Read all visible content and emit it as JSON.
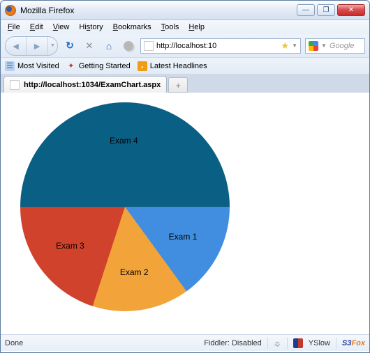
{
  "window": {
    "title": "Mozilla Firefox"
  },
  "menu": {
    "file": "File",
    "edit": "Edit",
    "view": "View",
    "history": "History",
    "bookmarks": "Bookmarks",
    "tools": "Tools",
    "help": "Help"
  },
  "toolbar": {
    "url_display": "http://localhost:10",
    "search_placeholder": "Google"
  },
  "bookmarks": {
    "most_visited": "Most Visited",
    "getting_started": "Getting Started",
    "latest_headlines": "Latest Headlines"
  },
  "tab": {
    "title": "http://localhost:1034/ExamChart.aspx"
  },
  "status": {
    "left": "Done",
    "fiddler": "Fiddler: Disabled",
    "yslow": "YSlow",
    "s3fox_s3": "S3",
    "s3fox_fox": "Fox"
  },
  "chart_data": {
    "type": "pie",
    "title": "",
    "series": [
      {
        "name": "Exam 1",
        "value": 15,
        "color": "#418ee0"
      },
      {
        "name": "Exam 2",
        "value": 15,
        "color": "#f2a43b"
      },
      {
        "name": "Exam 3",
        "value": 20,
        "color": "#d1422c"
      },
      {
        "name": "Exam 4",
        "value": 50,
        "color": "#0a5f85"
      }
    ]
  }
}
